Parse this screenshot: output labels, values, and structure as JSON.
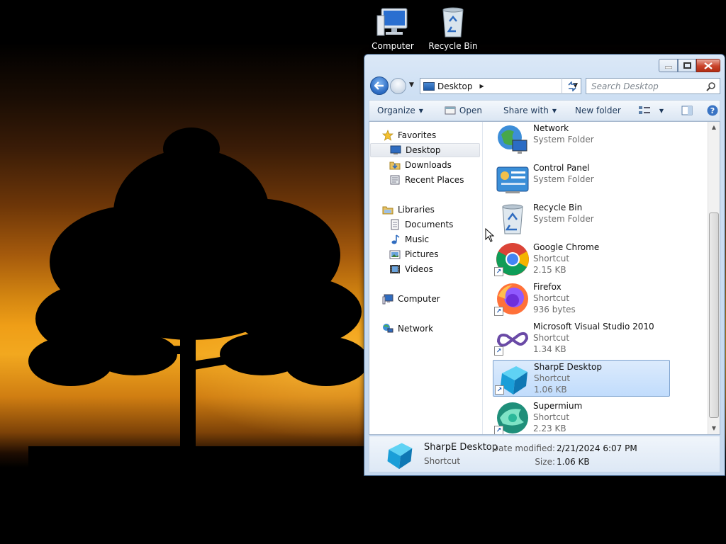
{
  "desktop": {
    "icons": [
      {
        "label": "Computer",
        "icon": "computer-icon"
      },
      {
        "label": "Recycle Bin",
        "icon": "recycle-bin-icon"
      }
    ]
  },
  "window": {
    "address": {
      "location": "Desktop"
    },
    "search": {
      "placeholder": "Search Desktop"
    },
    "toolbar": {
      "organize": "Organize",
      "open": "Open",
      "share_with": "Share with",
      "new_folder": "New folder"
    },
    "nav": {
      "favorites": "Favorites",
      "favorites_items": [
        "Desktop",
        "Downloads",
        "Recent Places"
      ],
      "libraries": "Libraries",
      "libraries_items": [
        "Documents",
        "Music",
        "Pictures",
        "Videos"
      ],
      "computer": "Computer",
      "network": "Network",
      "selected": "Desktop"
    },
    "files": [
      {
        "name": "Network",
        "type": "System Folder",
        "size": "",
        "icon": "network-icon"
      },
      {
        "name": "Control Panel",
        "type": "System Folder",
        "size": "",
        "icon": "control-panel-icon"
      },
      {
        "name": "Recycle Bin",
        "type": "System Folder",
        "size": "",
        "icon": "recycle-bin-icon"
      },
      {
        "name": "Google Chrome",
        "type": "Shortcut",
        "size": "2.15 KB",
        "icon": "chrome-icon"
      },
      {
        "name": "Firefox",
        "type": "Shortcut",
        "size": "936 bytes",
        "icon": "firefox-icon"
      },
      {
        "name": "Microsoft Visual Studio 2010",
        "type": "Shortcut",
        "size": "1.34 KB",
        "icon": "visual-studio-icon"
      },
      {
        "name": "SharpE Desktop",
        "type": "Shortcut",
        "size": "1.06 KB",
        "icon": "sharpe-cube-icon",
        "selected": true
      },
      {
        "name": "Supermium",
        "type": "Shortcut",
        "size": "2.23 KB",
        "icon": "supermium-icon"
      }
    ],
    "details": {
      "name": "SharpE Desktop",
      "type": "Shortcut",
      "date_label": "Date modified:",
      "date_value": "2/21/2024 6:07 PM",
      "size_label": "Size:",
      "size_value": "1.06 KB"
    }
  }
}
